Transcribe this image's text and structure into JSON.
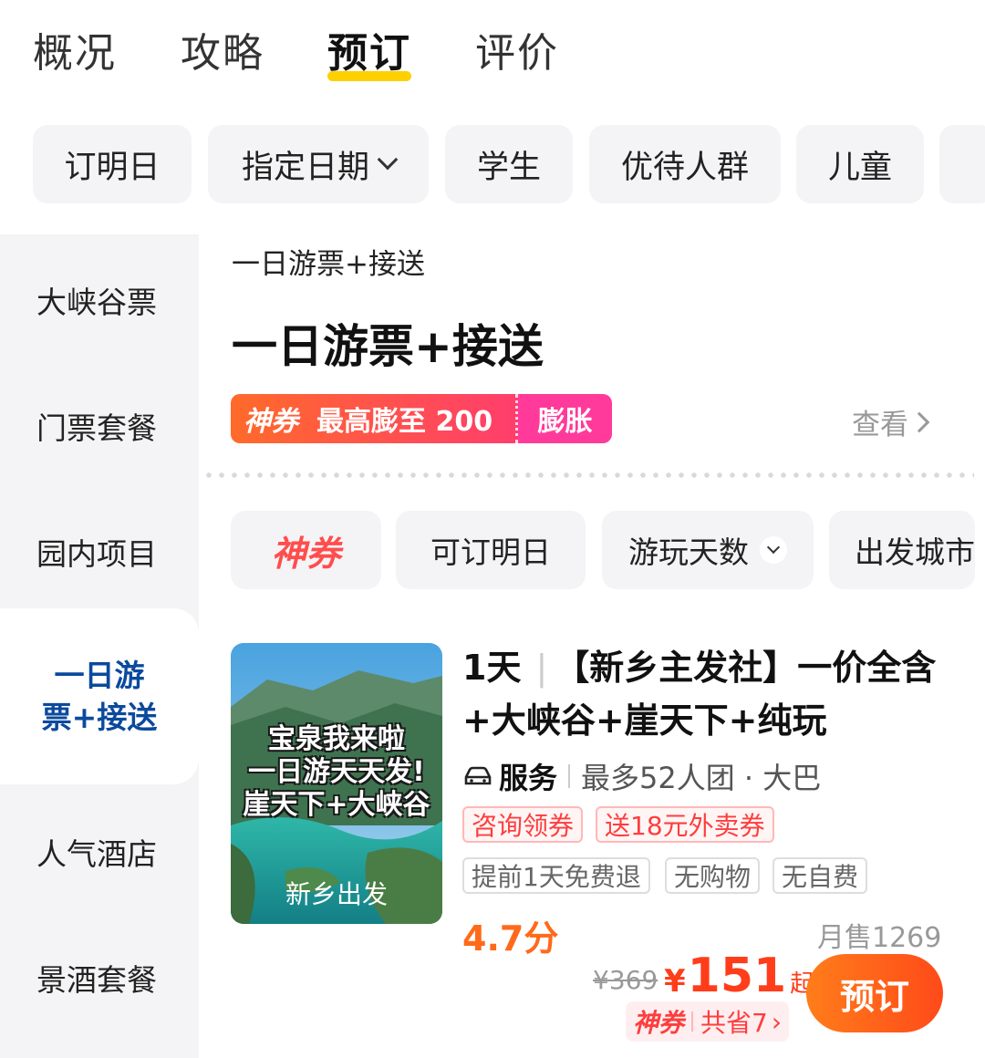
{
  "tabs": [
    {
      "label": "概况"
    },
    {
      "label": "攻略"
    },
    {
      "label": "预订",
      "active": true
    },
    {
      "label": "评价"
    }
  ],
  "filters": [
    {
      "label": "订明日"
    },
    {
      "label": "指定日期",
      "icon": "chevron-down-icon"
    },
    {
      "label": "学生"
    },
    {
      "label": "优待人群"
    },
    {
      "label": "儿童"
    }
  ],
  "sidebar": {
    "items": [
      {
        "label": "大峡谷票"
      },
      {
        "label": "门票套餐"
      },
      {
        "label": "园内项目"
      },
      {
        "label": "一日游票+接送",
        "line1": "一日游",
        "line2": "票+接送",
        "active": true
      },
      {
        "label": "人气酒店"
      },
      {
        "label": "景酒套餐"
      }
    ]
  },
  "content": {
    "category_label": "一日游票+接送",
    "section_title": "一日游票+接送",
    "coupon": {
      "brand": "神券",
      "text": "最高膨至 200",
      "action": "膨胀"
    },
    "see_more": "查看",
    "sub_filters": [
      {
        "label": "神券",
        "brand": true
      },
      {
        "label": "可订明日"
      },
      {
        "label": "游玩天数",
        "icon": "chevron-down-icon"
      },
      {
        "label": "出发城市"
      }
    ]
  },
  "product": {
    "thumb": {
      "overlay_lines": [
        "宝泉我来啦",
        "一日游天天发!",
        "崖天下+大峡谷"
      ],
      "caption": "新乡出发"
    },
    "days": "1天",
    "title": "【新乡主发社】一价全含+大峡谷+崖天下+纯玩",
    "service": "服务",
    "group_info": "最多52人团 · 大巴",
    "promo_tags": [
      "咨询领券",
      "送18元外卖券"
    ],
    "feature_tags": [
      "提前1天免费退",
      "无购物",
      "无自费"
    ],
    "rating": "4.7分",
    "monthly_sales": "月售1269",
    "original_price": "¥369",
    "currency": "¥",
    "price": "151",
    "price_suffix": "起",
    "saving_brand": "神券",
    "saving_text": "共省7",
    "book_label": "预订"
  },
  "colors": {
    "accent_yellow": "#ffd000",
    "price_red": "#ff3d1a",
    "rating_orange": "#ff6a1a",
    "active_blue": "#0b4a9c",
    "book_gradient_start": "#ff7d1a",
    "book_gradient_end": "#ff4a1a"
  }
}
